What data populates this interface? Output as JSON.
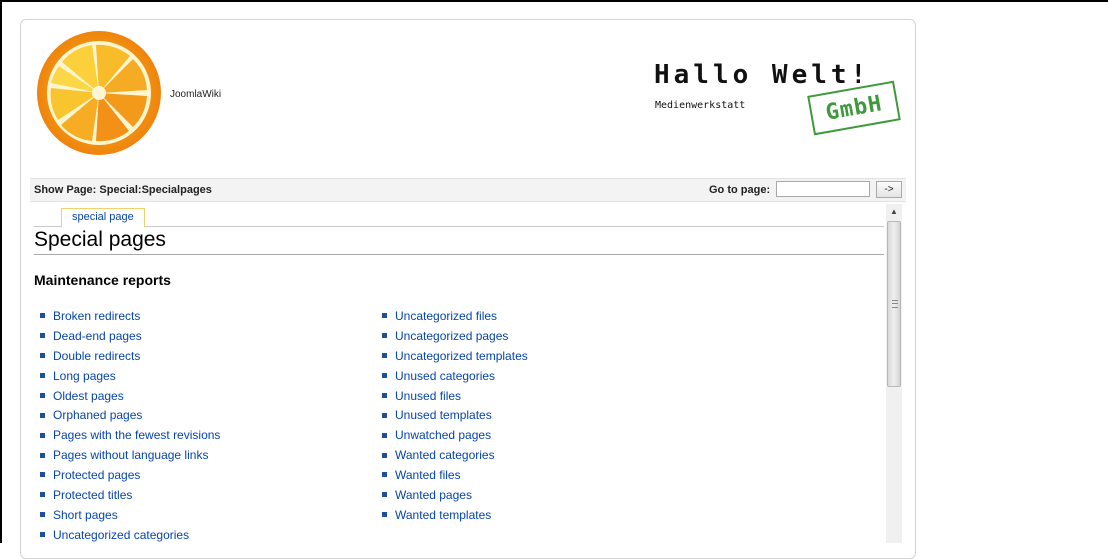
{
  "header": {
    "site_name": "JoomlaWiki",
    "brand": {
      "title": "Hallo Welt!",
      "subtitle": "Medienwerkstatt",
      "stamp": "GmbH"
    }
  },
  "toolbar": {
    "show_page": "Show Page: Special:Specialpages",
    "goto_label": "Go to page:",
    "goto_value": "",
    "goto_button": "->"
  },
  "content": {
    "tab": "special page",
    "title": "Special pages",
    "section": "Maintenance reports",
    "left_links": [
      "Broken redirects",
      "Dead-end pages",
      "Double redirects",
      "Long pages",
      "Oldest pages",
      "Orphaned pages",
      "Pages with the fewest revisions",
      "Pages without language links",
      "Protected pages",
      "Protected titles",
      "Short pages",
      "Uncategorized categories"
    ],
    "right_links": [
      "Uncategorized files",
      "Uncategorized pages",
      "Uncategorized templates",
      "Unused categories",
      "Unused files",
      "Unused templates",
      "Unwatched pages",
      "Wanted categories",
      "Wanted files",
      "Wanted pages",
      "Wanted templates"
    ]
  },
  "colors": {
    "link": "#0645ad",
    "tab_border": "#f3d26b",
    "stamp": "#3f9a3c",
    "logo_orange": "#f08a0c"
  },
  "icons": {
    "logo": "orange-slice-logo",
    "scroll_up": "arrow-up-icon",
    "scroll_grip": "grip-icon",
    "bullet": "square-bullet-icon"
  }
}
